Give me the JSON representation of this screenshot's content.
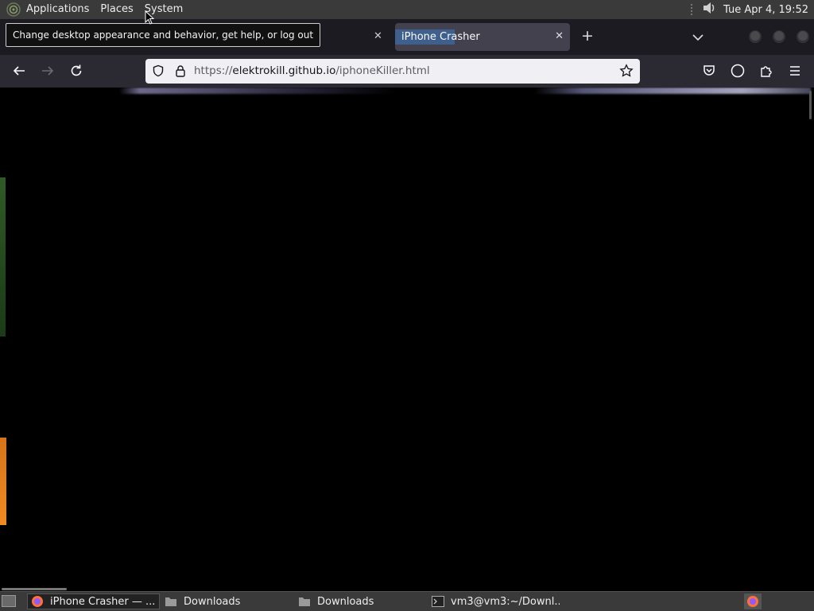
{
  "top_panel": {
    "menus": [
      "Applications",
      "Places",
      "System"
    ],
    "clock": "Tue Apr  4, 19:52"
  },
  "tooltip": {
    "text": "Change desktop appearance and behavior, get help, or log out"
  },
  "browser": {
    "active_tab": {
      "title": "iPhone Crasher"
    },
    "url": {
      "prefix": "https://",
      "domain": "elektrokill.github.io",
      "path": "/iphoneKiller.html"
    }
  },
  "taskbar": {
    "items": [
      {
        "label": "iPhone Crasher — ...",
        "icon": "firefox-icon",
        "active": true
      },
      {
        "label": "Downloads",
        "icon": "folder-icon",
        "active": false
      },
      {
        "label": "Downloads",
        "icon": "folder-icon",
        "active": false
      },
      {
        "label": "vm3@vm3:~/Downl...",
        "icon": "terminal-icon",
        "active": false
      }
    ]
  },
  "colors": {
    "panel": "#3a3a3a",
    "tabbar": "#1c1b22",
    "navbar": "#2b2a33",
    "urlbar": "#f0f0f4",
    "page": "#000000"
  }
}
